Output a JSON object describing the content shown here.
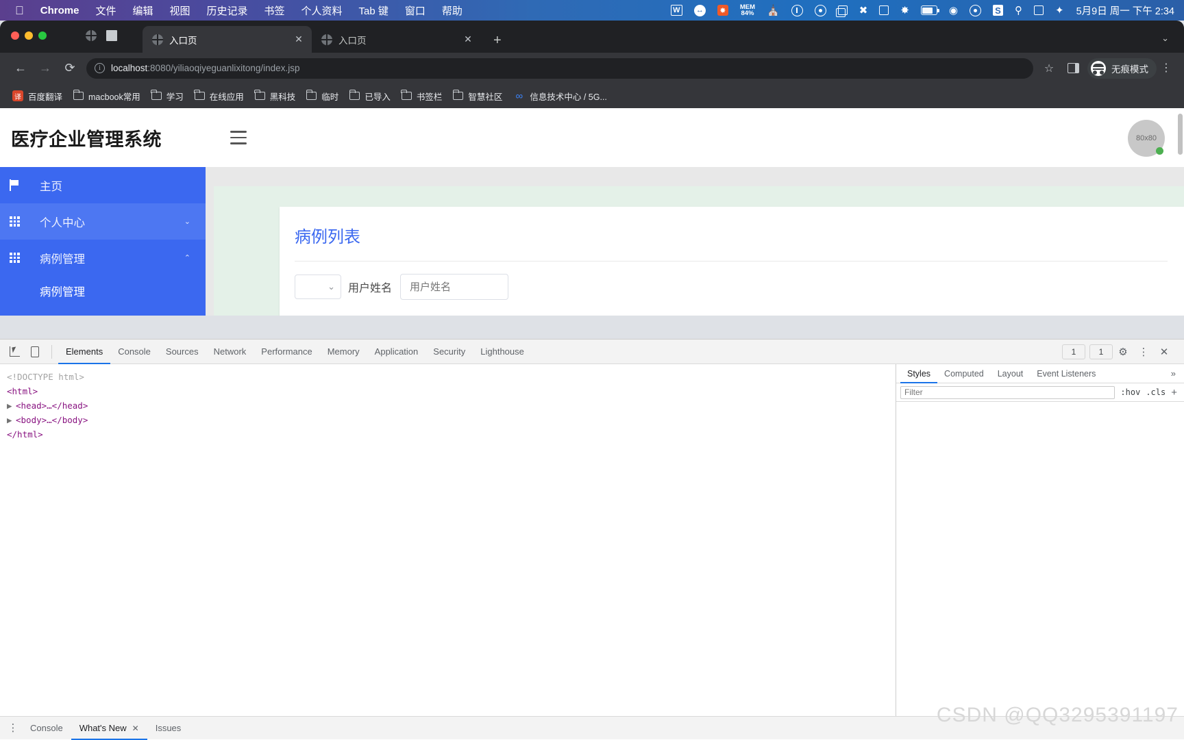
{
  "macbar": {
    "apple_icon": "apple-icon",
    "app_name": "Chrome",
    "menus": [
      "文件",
      "编辑",
      "视图",
      "历史记录",
      "书签",
      "个人资料",
      "Tab 键",
      "窗口",
      "帮助"
    ],
    "status": {
      "wps": "W",
      "mem_label": "MEM",
      "mem_value": "84%",
      "sogou": "S"
    },
    "clock": "5月9日 周一 下午 2:34"
  },
  "browser": {
    "tabs": [
      {
        "title": "入口页",
        "active": true,
        "close": "✕"
      },
      {
        "title": "入口页",
        "active": false,
        "close": "✕"
      }
    ],
    "new_tab": "+",
    "tab_list_caret": "⌄",
    "nav": {
      "back": "←",
      "forward": "→",
      "reload": "⟳"
    },
    "omnibox": {
      "info_icon": "ⓘ",
      "url_host": "localhost",
      "url_path": ":8080/yiliaoqiyeguanlixitong/index.jsp"
    },
    "star": "☆",
    "incognito_label": "无痕模式",
    "bookmarks": [
      {
        "icon": "translate-icon",
        "label": "百度翻译"
      },
      {
        "icon": "folder-icon",
        "label": "macbook常用"
      },
      {
        "icon": "folder-icon",
        "label": "学习"
      },
      {
        "icon": "folder-icon",
        "label": "在线应用"
      },
      {
        "icon": "folder-icon",
        "label": "黑科技"
      },
      {
        "icon": "folder-icon",
        "label": "临时"
      },
      {
        "icon": "folder-icon",
        "label": "已导入"
      },
      {
        "icon": "folder-icon",
        "label": "书签栏"
      },
      {
        "icon": "folder-icon",
        "label": "智慧社区"
      },
      {
        "icon": "link-icon",
        "label": "信息技术中心 / 5G..."
      }
    ]
  },
  "webpage": {
    "brand": "医疗企业管理系统",
    "avatar_text": "80x80",
    "sidebar": [
      {
        "icon": "flag-icon",
        "label": "主页",
        "caret": "",
        "state": "normal"
      },
      {
        "icon": "grid-icon",
        "label": "个人中心",
        "caret": "⌄",
        "state": "hover"
      },
      {
        "icon": "grid-icon",
        "label": "病例管理",
        "caret": "⌃",
        "state": "expanded"
      }
    ],
    "submenu": [
      {
        "label": "病例管理"
      }
    ],
    "card": {
      "title": "病例列表",
      "filter": {
        "select_value": "",
        "select_caret": "⌄",
        "label": "用户姓名",
        "input_value": "",
        "input_placeholder": "用户姓名"
      }
    },
    "accent_color": "#3b68f0"
  },
  "devtools": {
    "tabs": [
      "Elements",
      "Console",
      "Sources",
      "Network",
      "Performance",
      "Memory",
      "Application",
      "Security",
      "Lighthouse"
    ],
    "active_tab": "Elements",
    "badges": [
      "1",
      "1"
    ],
    "settings_icon": "gear-icon",
    "more_icon": "kebab-icon",
    "close_icon": "close-icon",
    "dom": [
      {
        "text": "<!DOCTYPE html>",
        "type": "doctype",
        "tri": ""
      },
      {
        "text": "<html>",
        "type": "tag",
        "tri": ""
      },
      {
        "text": "<head>…</head>",
        "type": "tag",
        "tri": "▶"
      },
      {
        "text": "<body>…</body>",
        "type": "tag",
        "tri": "▶"
      },
      {
        "text": "</html>",
        "type": "tag",
        "tri": ""
      }
    ],
    "styles": {
      "tabs": [
        "Styles",
        "Computed",
        "Layout",
        "Event Listeners"
      ],
      "active_tab": "Styles",
      "overflow": "»",
      "filter_placeholder": "Filter",
      "hov": ":hov",
      "cls": ".cls",
      "plus": "+"
    },
    "footer": {
      "tabs": [
        {
          "label": "Console",
          "active": false,
          "closeable": false
        },
        {
          "label": "What's New",
          "active": true,
          "closeable": true
        },
        {
          "label": "Issues",
          "active": false,
          "closeable": false
        }
      ],
      "close": "✕"
    }
  },
  "watermark": "CSDN @QQ3295391197"
}
